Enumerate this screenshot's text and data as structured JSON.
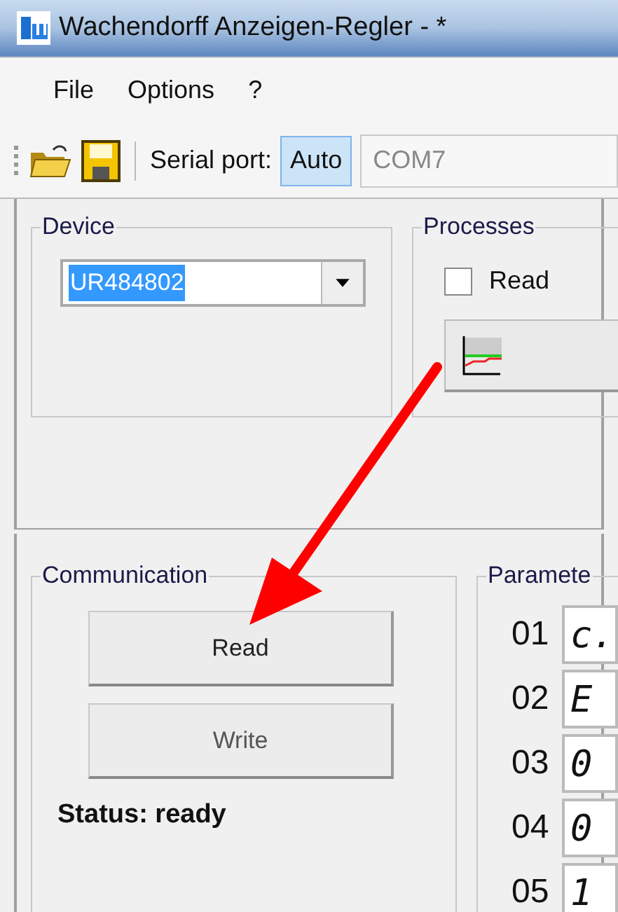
{
  "window": {
    "title": "Wachendorff Anzeigen-Regler -  *"
  },
  "menu": [
    "File",
    "Options",
    "?"
  ],
  "toolbar": {
    "port_label": "Serial port:",
    "auto": {
      "label": "Auto",
      "selected": true
    },
    "port": "COM7"
  },
  "device": {
    "title": "Device",
    "value": "UR484802"
  },
  "processes": {
    "title": "Processes",
    "read": {
      "label": "Read",
      "checked": false
    }
  },
  "communication": {
    "title": "Communication",
    "buttons": [
      "Read",
      "Write"
    ],
    "status": "Status: ready"
  },
  "parameters": {
    "title": "Paramete",
    "rows": [
      {
        "number": "01",
        "value": "c."
      },
      {
        "number": "02",
        "value": "E"
      },
      {
        "number": "03",
        "value": "0"
      },
      {
        "number": "04",
        "value": "0"
      },
      {
        "number": "05",
        "value": "1"
      }
    ]
  }
}
